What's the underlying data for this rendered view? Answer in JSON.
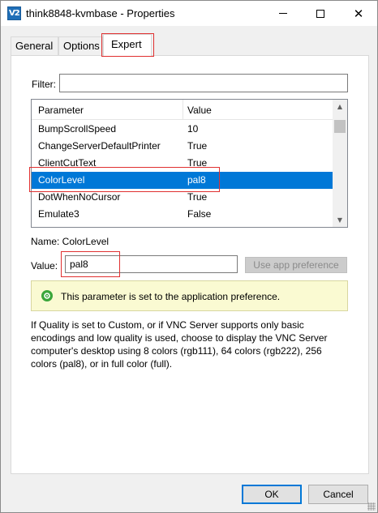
{
  "window": {
    "title": "think8848-kvmbase - Properties",
    "app_icon_text": "V2",
    "minimize": "minimize",
    "maximize": "maximize",
    "close": "✕"
  },
  "tabs": [
    {
      "label": "General"
    },
    {
      "label": "Options"
    },
    {
      "label": "Expert",
      "active": true
    }
  ],
  "filter": {
    "label": "Filter:",
    "value": ""
  },
  "list": {
    "columns": [
      "Parameter",
      "Value"
    ],
    "rows": [
      {
        "param": "BumpScrollSpeed",
        "value": "10"
      },
      {
        "param": "ChangeServerDefaultPrinter",
        "value": "True"
      },
      {
        "param": "ClientCutText",
        "value": "True"
      },
      {
        "param": "ColorLevel",
        "value": "pal8",
        "selected": true
      },
      {
        "param": "DotWhenNoCursor",
        "value": "True"
      },
      {
        "param": "Emulate3",
        "value": "False"
      }
    ]
  },
  "detail": {
    "name_line": "Name: ColorLevel",
    "value_label": "Value:",
    "value": "pal8",
    "use_app_button": "Use app preference"
  },
  "info": {
    "text": "This parameter is set to the application preference.",
    "icon_color": "#3aa63a"
  },
  "description": "If Quality is set to Custom, or if VNC Server supports only basic encodings and low quality is used, choose to display the VNC Server computer's desktop using 8 colors (rgb111), 64 colors (rgb222), 256 colors (pal8), or in full color (full).",
  "footer": {
    "ok": "OK",
    "cancel": "Cancel"
  },
  "colors": {
    "selection": "#0078d7",
    "annotation": "#e03030",
    "info_bg": "#fafad2"
  }
}
